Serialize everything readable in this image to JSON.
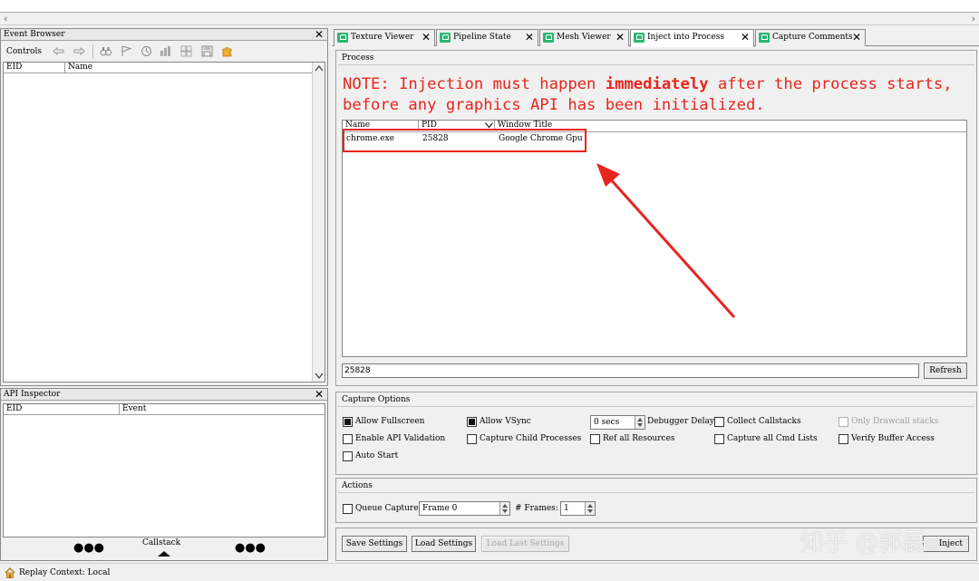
{
  "event_browser": {
    "title": "Event Browser",
    "controls_label": "Controls",
    "columns": [
      "EID",
      "Name"
    ]
  },
  "api_inspector": {
    "title": "API Inspector",
    "columns": [
      "EID",
      "Event"
    ],
    "callstack_label": "Callstack"
  },
  "tabs": [
    {
      "label": "Texture Viewer"
    },
    {
      "label": "Pipeline State"
    },
    {
      "label": "Mesh Viewer"
    },
    {
      "label": "Inject into Process"
    },
    {
      "label": "Capture Comments"
    }
  ],
  "process": {
    "group_title": "Process",
    "note_prefix": "NOTE: Injection must happen ",
    "note_bold": "immediately",
    "note_suffix": " after the process starts,",
    "note_line2": "before any graphics API has been initialized.",
    "columns": [
      "Name",
      "PID",
      "Window Title"
    ],
    "rows": [
      {
        "name": "chrome.exe",
        "pid": "25828",
        "title": "Google Chrome Gpu"
      }
    ],
    "filter_value": "25828",
    "refresh_label": "Refresh"
  },
  "capture_options": {
    "group_title": "Capture Options",
    "allow_fullscreen": "Allow Fullscreen",
    "allow_vsync": "Allow VSync",
    "delay_value": "0 secs",
    "debugger_delay": "Debugger Delay",
    "collect_callstacks": "Collect Callstacks",
    "only_drawcall_stacks": "Only Drawcall stacks",
    "enable_api_validation": "Enable API Validation",
    "capture_child": "Capture Child Processes",
    "ref_all_resources": "Ref all Resources",
    "capture_all_cmd": "Capture all Cmd Lists",
    "verify_buffer": "Verify Buffer Access",
    "auto_start": "Auto Start"
  },
  "actions": {
    "group_title": "Actions",
    "queue_capture": "Queue Capture",
    "frame_value": "Frame 0",
    "frames_label": "# Frames:",
    "frames_value": "1"
  },
  "buttons": {
    "save_settings": "Save Settings",
    "load_settings": "Load Settings",
    "load_last_settings": "Load Last Settings",
    "inject": "Inject"
  },
  "status_bar": {
    "text": "Replay Context: Local"
  },
  "watermark": "知乎 @郭磊",
  "colors": {
    "note_red": "#e8251e",
    "annotation_red": "#e8251e",
    "tab_icon_green": "#2bb673"
  }
}
